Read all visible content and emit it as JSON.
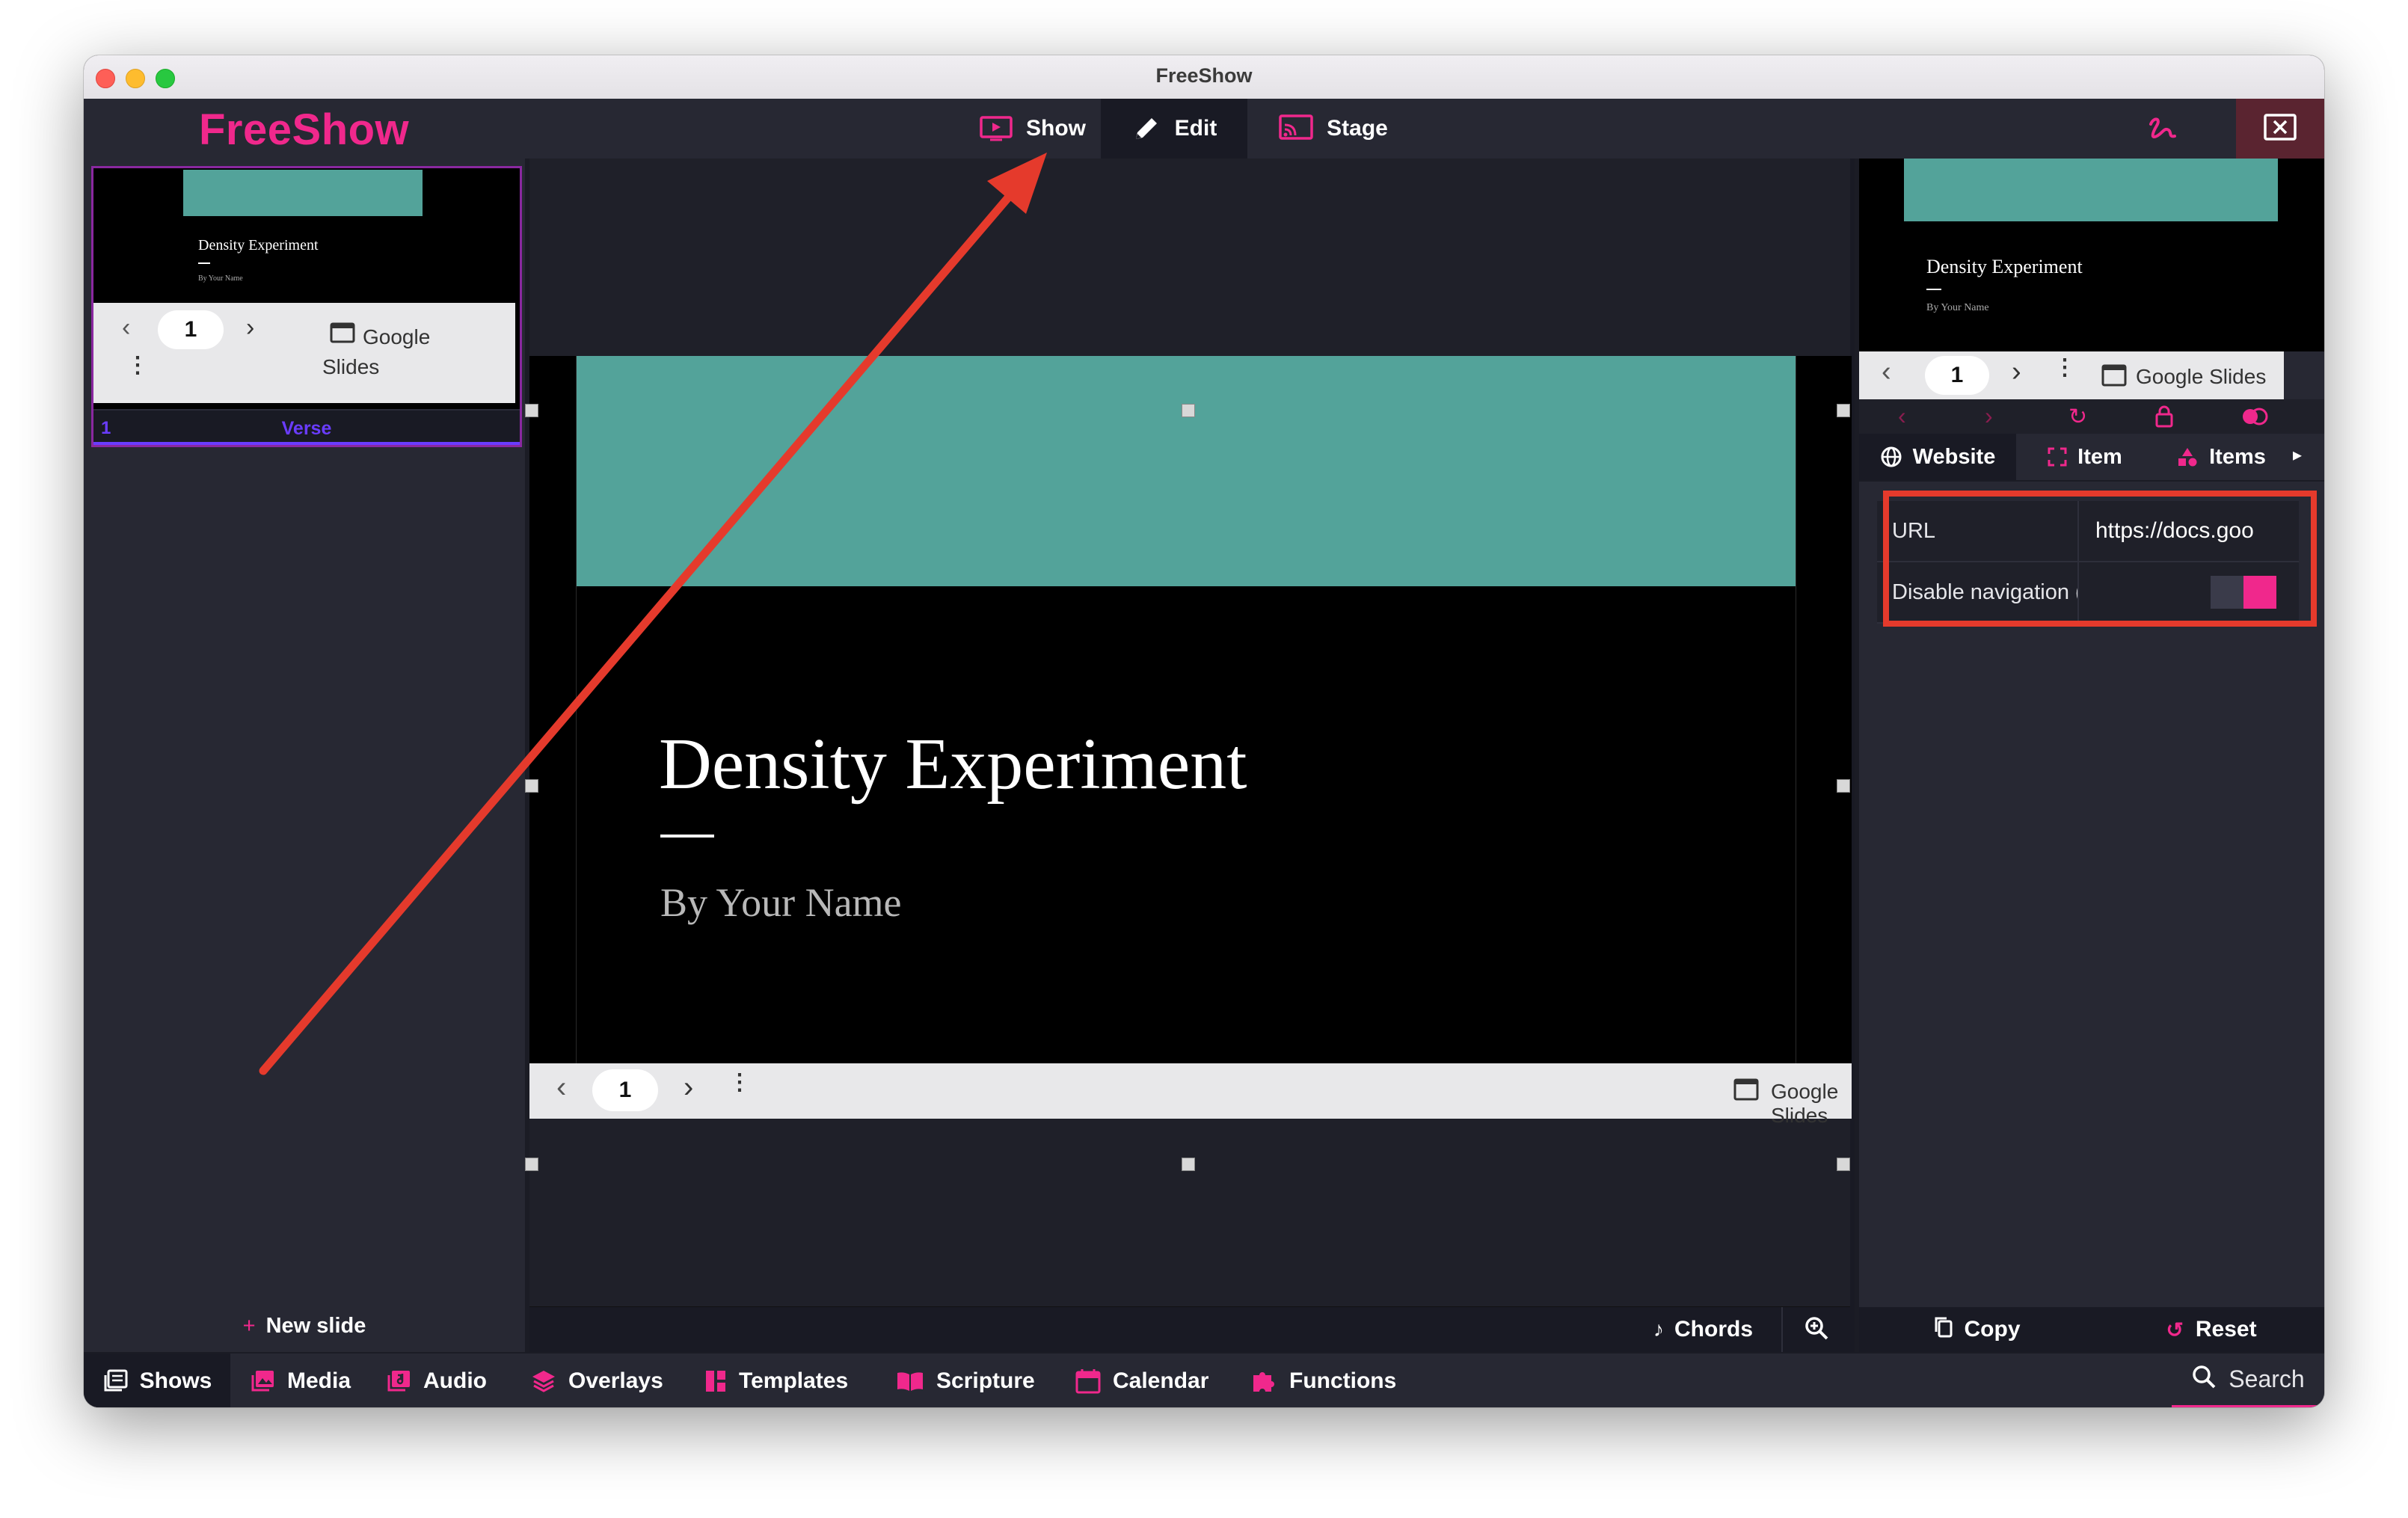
{
  "window": {
    "title": "FreeShow"
  },
  "topbar": {
    "brand": "FreeShow",
    "tabs": [
      {
        "label": "Show",
        "icon": "presentation-play-icon"
      },
      {
        "label": "Edit",
        "icon": "pencil-icon",
        "active": true
      },
      {
        "label": "Stage",
        "icon": "cast-screen-icon"
      }
    ],
    "icons": [
      "draw-icon",
      "settings-gear-icon",
      "close-output-icon"
    ]
  },
  "left_panel": {
    "slide_number": "1",
    "slide_group": "Verse",
    "new_slide_label": "New slide"
  },
  "slide": {
    "title": "Density Experiment",
    "subtitle": "By Your Name",
    "page_number": "1",
    "source_label_line1": "Google",
    "source_label_line2": "Slides",
    "source_label": "Google Slides"
  },
  "center_bottom": {
    "chords_label": "Chords"
  },
  "right_panel": {
    "tabs": [
      {
        "label": "Website",
        "icon": "globe-icon",
        "active": true
      },
      {
        "label": "Item",
        "icon": "frame-icon"
      },
      {
        "label": "Items",
        "icon": "shapes-icon"
      }
    ],
    "properties": [
      {
        "label": "URL",
        "value": "https://docs.goo"
      },
      {
        "label": "Disable navigation (",
        "value": ""
      }
    ],
    "disable_navigation_enabled": true,
    "copy_label": "Copy",
    "reset_label": "Reset"
  },
  "bottom_tabs": [
    {
      "label": "Shows",
      "icon": "shows-icon",
      "active": true
    },
    {
      "label": "Media",
      "icon": "image-icon"
    },
    {
      "label": "Audio",
      "icon": "music-icon"
    },
    {
      "label": "Overlays",
      "icon": "layers-icon"
    },
    {
      "label": "Templates",
      "icon": "templates-icon"
    },
    {
      "label": "Scripture",
      "icon": "book-icon"
    },
    {
      "label": "Calendar",
      "icon": "calendar-icon"
    },
    {
      "label": "Functions",
      "icon": "puzzle-icon"
    }
  ],
  "search_label": "Search",
  "colors": {
    "accent": "#f0288c",
    "teal": "#53a39a",
    "annotation_red": "#e53a2c"
  }
}
